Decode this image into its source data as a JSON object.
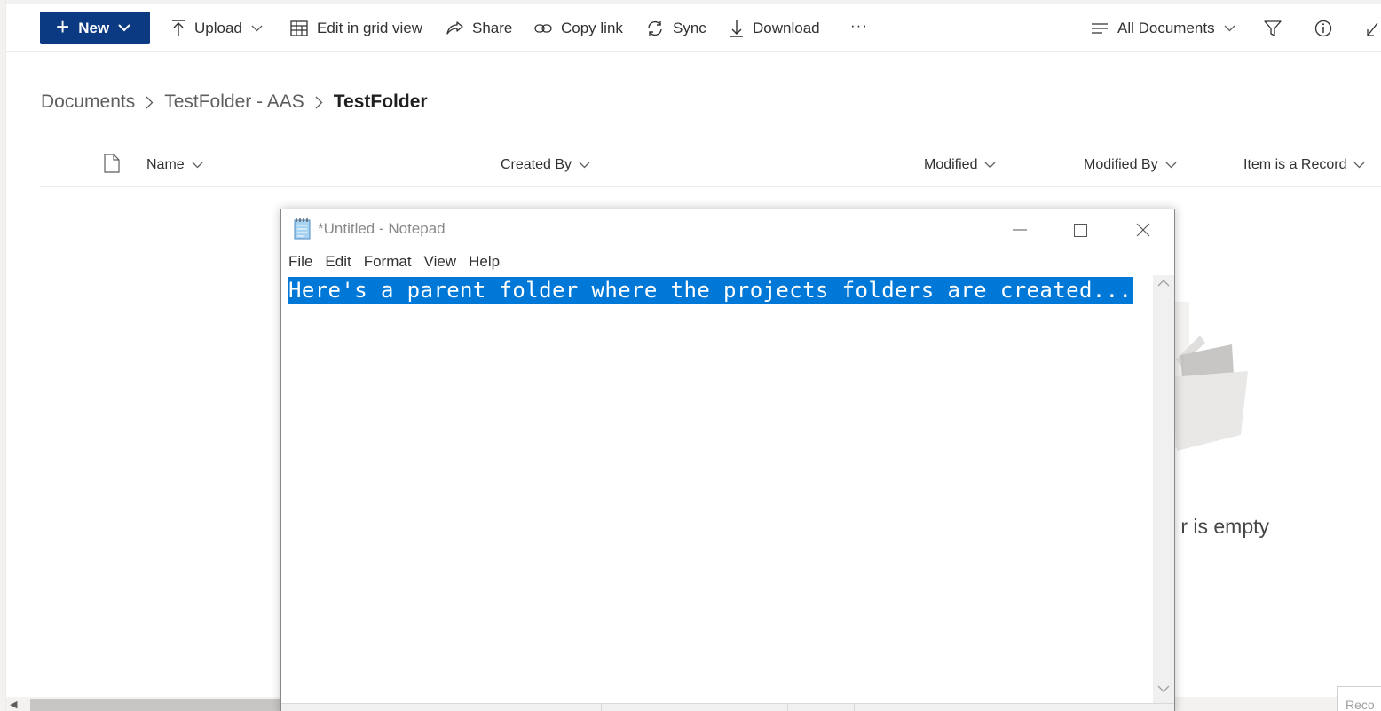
{
  "commandbar": {
    "new_label": "New",
    "upload_label": "Upload",
    "grid_label": "Edit in grid view",
    "share_label": "Share",
    "copylink_label": "Copy link",
    "sync_label": "Sync",
    "download_label": "Download",
    "more_label": "···",
    "view_label": "All Documents"
  },
  "breadcrumb": {
    "items": [
      "Documents",
      "TestFolder - AAS"
    ],
    "current": "TestFolder"
  },
  "columns": {
    "name": "Name",
    "created_by": "Created By",
    "modified": "Modified",
    "modified_by": "Modified By",
    "item_is_record": "Item is a Record"
  },
  "empty_state": {
    "text_visible": "r is empty"
  },
  "reco_label": "Reco",
  "notepad": {
    "title": "*Untitled - Notepad",
    "menu": [
      "File",
      "Edit",
      "Format",
      "View",
      "Help"
    ],
    "selected_text": "Here's a parent folder where the projects folders are created...",
    "selection_color": "#0078d7"
  },
  "colors": {
    "accent": "#0b3a82",
    "text": "#323130"
  }
}
